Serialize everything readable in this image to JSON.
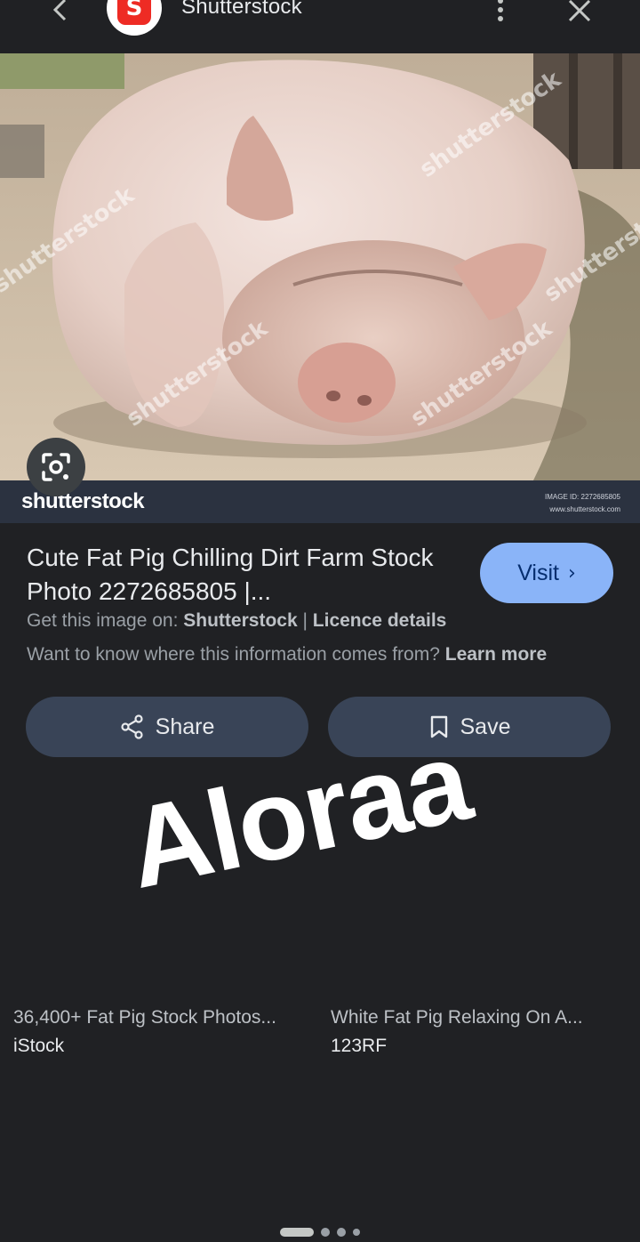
{
  "header": {
    "site_name": "Shutterstock",
    "logo_letter": "S",
    "back_icon": "chevron-left-icon",
    "more_icon": "more-vert-icon",
    "close_icon": "close-icon"
  },
  "image": {
    "watermark_brand": "shutterstock",
    "watermark_id": "IMAGE ID: 2272685805",
    "watermark_url": "www.shutterstock.com",
    "lens_icon": "lens-icon"
  },
  "result": {
    "title": "Cute Fat Pig Chilling Dirt Farm Stock Photo 2272685805 |...",
    "visit_label": "Visit",
    "source_prefix": "Get this image on:",
    "source_name": "Shutterstock",
    "separator": "|",
    "licence_label": "Licence details",
    "info_question": "Want to know where this information comes from?",
    "learn_more": "Learn more"
  },
  "actions": {
    "share_label": "Share",
    "save_label": "Save"
  },
  "overlay": {
    "text": "Aloraa"
  },
  "related": [
    {
      "title": "36,400+ Fat Pig Stock Photos...",
      "source": "iStock"
    },
    {
      "title": "White Fat Pig Relaxing On A...",
      "source": "123RF"
    }
  ],
  "pager": {
    "count": 4,
    "active_index": 0
  },
  "colors": {
    "background": "#202124",
    "visit_button": "#8ab4f8",
    "action_button": "#394457",
    "logo": "#ee2b24"
  }
}
